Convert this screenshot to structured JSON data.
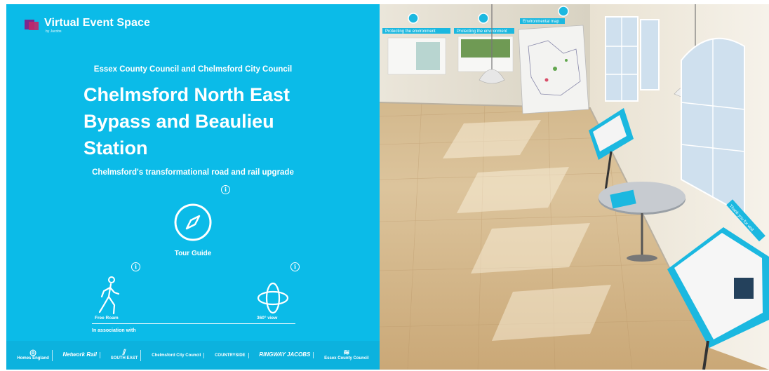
{
  "brand": {
    "title": "Virtual Event Space",
    "subtitle": "by Jacobs"
  },
  "header": {
    "council": "Essex County Council and Chelmsford City Council",
    "title_line1": "Chelmsford North East",
    "title_line2": "Bypass and Beaulieu",
    "title_line3": "Station",
    "tagline": "Chelmsford's transformational road and rail upgrade"
  },
  "modes": {
    "tour_guide": "Tour Guide",
    "free_roam": "Free Roam",
    "view_360": "360° view",
    "info_glyph": "i"
  },
  "association": "In association with",
  "partners": [
    {
      "name": "Homes England"
    },
    {
      "name": "Network Rail"
    },
    {
      "name": "SOUTH EAST"
    },
    {
      "name": "Chelmsford City Council"
    },
    {
      "name": "COUNTRYSIDE"
    },
    {
      "name": "RINGWAY JACOBS"
    },
    {
      "name": "Essex County Council"
    }
  ],
  "scene": {
    "labels": [
      "Protecting the environment",
      "Protecting the environment",
      "Environmental map",
      "Thank you for visit"
    ]
  },
  "colors": {
    "panel": "#0bbbe8",
    "accent": "#1bb8e0",
    "floor": "#d4b88a",
    "wall": "#f0ede4"
  }
}
